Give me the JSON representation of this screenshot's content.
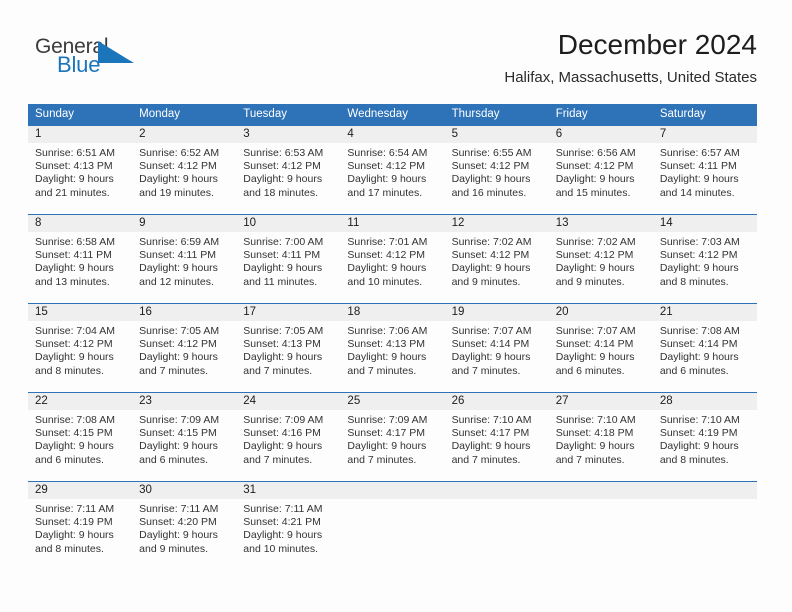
{
  "brand": {
    "name_part1": "General",
    "name_part2": "Blue",
    "triangle_color": "#1b75bb",
    "text_color": "#3b3b3b"
  },
  "header": {
    "title": "December 2024",
    "subtitle": "Halifax, Massachusetts, United States"
  },
  "theme": {
    "header_blue": "#2e72b8",
    "number_band": "#efefef",
    "page_background": "#fdfdfd",
    "body_text": "#333333"
  },
  "weekdays": [
    "Sunday",
    "Monday",
    "Tuesday",
    "Wednesday",
    "Thursday",
    "Friday",
    "Saturday"
  ],
  "weeks": [
    {
      "days": [
        {
          "num": "1",
          "sunrise": "Sunrise: 6:51 AM",
          "sunset": "Sunset: 4:13 PM",
          "daylight1": "Daylight: 9 hours",
          "daylight2": "and 21 minutes."
        },
        {
          "num": "2",
          "sunrise": "Sunrise: 6:52 AM",
          "sunset": "Sunset: 4:12 PM",
          "daylight1": "Daylight: 9 hours",
          "daylight2": "and 19 minutes."
        },
        {
          "num": "3",
          "sunrise": "Sunrise: 6:53 AM",
          "sunset": "Sunset: 4:12 PM",
          "daylight1": "Daylight: 9 hours",
          "daylight2": "and 18 minutes."
        },
        {
          "num": "4",
          "sunrise": "Sunrise: 6:54 AM",
          "sunset": "Sunset: 4:12 PM",
          "daylight1": "Daylight: 9 hours",
          "daylight2": "and 17 minutes."
        },
        {
          "num": "5",
          "sunrise": "Sunrise: 6:55 AM",
          "sunset": "Sunset: 4:12 PM",
          "daylight1": "Daylight: 9 hours",
          "daylight2": "and 16 minutes."
        },
        {
          "num": "6",
          "sunrise": "Sunrise: 6:56 AM",
          "sunset": "Sunset: 4:12 PM",
          "daylight1": "Daylight: 9 hours",
          "daylight2": "and 15 minutes."
        },
        {
          "num": "7",
          "sunrise": "Sunrise: 6:57 AM",
          "sunset": "Sunset: 4:11 PM",
          "daylight1": "Daylight: 9 hours",
          "daylight2": "and 14 minutes."
        }
      ]
    },
    {
      "days": [
        {
          "num": "8",
          "sunrise": "Sunrise: 6:58 AM",
          "sunset": "Sunset: 4:11 PM",
          "daylight1": "Daylight: 9 hours",
          "daylight2": "and 13 minutes."
        },
        {
          "num": "9",
          "sunrise": "Sunrise: 6:59 AM",
          "sunset": "Sunset: 4:11 PM",
          "daylight1": "Daylight: 9 hours",
          "daylight2": "and 12 minutes."
        },
        {
          "num": "10",
          "sunrise": "Sunrise: 7:00 AM",
          "sunset": "Sunset: 4:11 PM",
          "daylight1": "Daylight: 9 hours",
          "daylight2": "and 11 minutes."
        },
        {
          "num": "11",
          "sunrise": "Sunrise: 7:01 AM",
          "sunset": "Sunset: 4:12 PM",
          "daylight1": "Daylight: 9 hours",
          "daylight2": "and 10 minutes."
        },
        {
          "num": "12",
          "sunrise": "Sunrise: 7:02 AM",
          "sunset": "Sunset: 4:12 PM",
          "daylight1": "Daylight: 9 hours",
          "daylight2": "and 9 minutes."
        },
        {
          "num": "13",
          "sunrise": "Sunrise: 7:02 AM",
          "sunset": "Sunset: 4:12 PM",
          "daylight1": "Daylight: 9 hours",
          "daylight2": "and 9 minutes."
        },
        {
          "num": "14",
          "sunrise": "Sunrise: 7:03 AM",
          "sunset": "Sunset: 4:12 PM",
          "daylight1": "Daylight: 9 hours",
          "daylight2": "and 8 minutes."
        }
      ]
    },
    {
      "days": [
        {
          "num": "15",
          "sunrise": "Sunrise: 7:04 AM",
          "sunset": "Sunset: 4:12 PM",
          "daylight1": "Daylight: 9 hours",
          "daylight2": "and 8 minutes."
        },
        {
          "num": "16",
          "sunrise": "Sunrise: 7:05 AM",
          "sunset": "Sunset: 4:12 PM",
          "daylight1": "Daylight: 9 hours",
          "daylight2": "and 7 minutes."
        },
        {
          "num": "17",
          "sunrise": "Sunrise: 7:05 AM",
          "sunset": "Sunset: 4:13 PM",
          "daylight1": "Daylight: 9 hours",
          "daylight2": "and 7 minutes."
        },
        {
          "num": "18",
          "sunrise": "Sunrise: 7:06 AM",
          "sunset": "Sunset: 4:13 PM",
          "daylight1": "Daylight: 9 hours",
          "daylight2": "and 7 minutes."
        },
        {
          "num": "19",
          "sunrise": "Sunrise: 7:07 AM",
          "sunset": "Sunset: 4:14 PM",
          "daylight1": "Daylight: 9 hours",
          "daylight2": "and 7 minutes."
        },
        {
          "num": "20",
          "sunrise": "Sunrise: 7:07 AM",
          "sunset": "Sunset: 4:14 PM",
          "daylight1": "Daylight: 9 hours",
          "daylight2": "and 6 minutes."
        },
        {
          "num": "21",
          "sunrise": "Sunrise: 7:08 AM",
          "sunset": "Sunset: 4:14 PM",
          "daylight1": "Daylight: 9 hours",
          "daylight2": "and 6 minutes."
        }
      ]
    },
    {
      "days": [
        {
          "num": "22",
          "sunrise": "Sunrise: 7:08 AM",
          "sunset": "Sunset: 4:15 PM",
          "daylight1": "Daylight: 9 hours",
          "daylight2": "and 6 minutes."
        },
        {
          "num": "23",
          "sunrise": "Sunrise: 7:09 AM",
          "sunset": "Sunset: 4:15 PM",
          "daylight1": "Daylight: 9 hours",
          "daylight2": "and 6 minutes."
        },
        {
          "num": "24",
          "sunrise": "Sunrise: 7:09 AM",
          "sunset": "Sunset: 4:16 PM",
          "daylight1": "Daylight: 9 hours",
          "daylight2": "and 7 minutes."
        },
        {
          "num": "25",
          "sunrise": "Sunrise: 7:09 AM",
          "sunset": "Sunset: 4:17 PM",
          "daylight1": "Daylight: 9 hours",
          "daylight2": "and 7 minutes."
        },
        {
          "num": "26",
          "sunrise": "Sunrise: 7:10 AM",
          "sunset": "Sunset: 4:17 PM",
          "daylight1": "Daylight: 9 hours",
          "daylight2": "and 7 minutes."
        },
        {
          "num": "27",
          "sunrise": "Sunrise: 7:10 AM",
          "sunset": "Sunset: 4:18 PM",
          "daylight1": "Daylight: 9 hours",
          "daylight2": "and 7 minutes."
        },
        {
          "num": "28",
          "sunrise": "Sunrise: 7:10 AM",
          "sunset": "Sunset: 4:19 PM",
          "daylight1": "Daylight: 9 hours",
          "daylight2": "and 8 minutes."
        }
      ]
    },
    {
      "days": [
        {
          "num": "29",
          "sunrise": "Sunrise: 7:11 AM",
          "sunset": "Sunset: 4:19 PM",
          "daylight1": "Daylight: 9 hours",
          "daylight2": "and 8 minutes."
        },
        {
          "num": "30",
          "sunrise": "Sunrise: 7:11 AM",
          "sunset": "Sunset: 4:20 PM",
          "daylight1": "Daylight: 9 hours",
          "daylight2": "and 9 minutes."
        },
        {
          "num": "31",
          "sunrise": "Sunrise: 7:11 AM",
          "sunset": "Sunset: 4:21 PM",
          "daylight1": "Daylight: 9 hours",
          "daylight2": "and 10 minutes."
        },
        {
          "num": "",
          "sunrise": "",
          "sunset": "",
          "daylight1": "",
          "daylight2": ""
        },
        {
          "num": "",
          "sunrise": "",
          "sunset": "",
          "daylight1": "",
          "daylight2": ""
        },
        {
          "num": "",
          "sunrise": "",
          "sunset": "",
          "daylight1": "",
          "daylight2": ""
        },
        {
          "num": "",
          "sunrise": "",
          "sunset": "",
          "daylight1": "",
          "daylight2": ""
        }
      ]
    }
  ]
}
